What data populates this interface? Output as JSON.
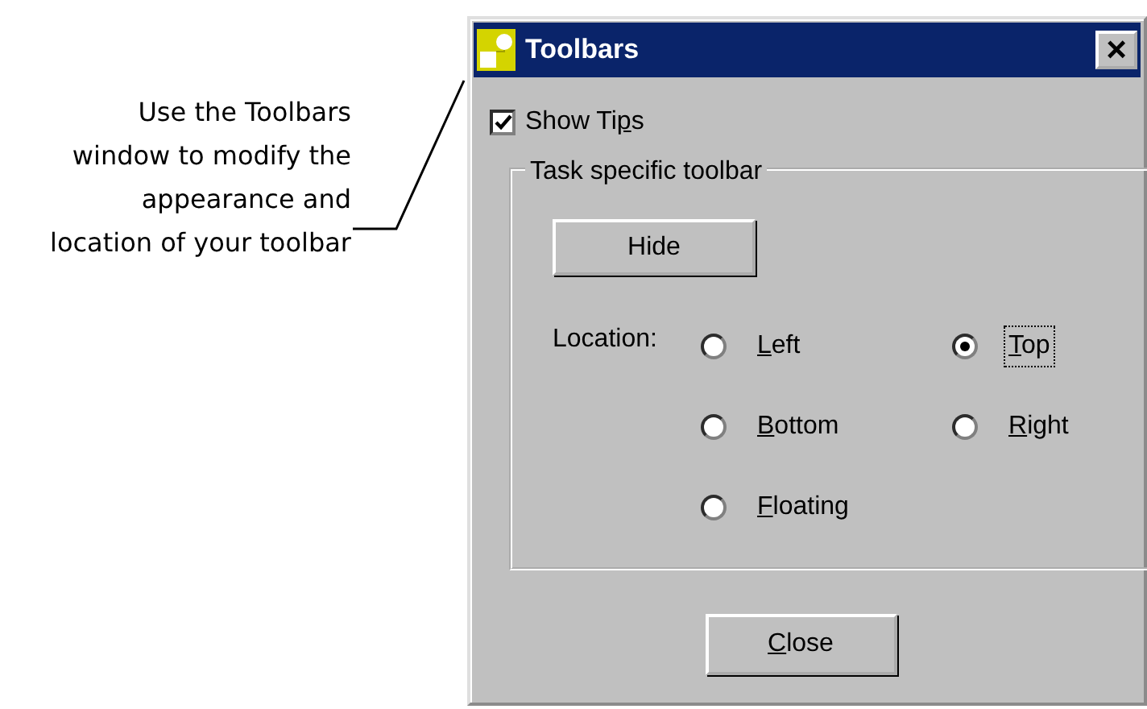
{
  "callout": {
    "text": "Use the Toolbars window to modify the appearance and location of your toolbar"
  },
  "window": {
    "title": "Toolbars",
    "close_glyph": "×"
  },
  "show_tips": {
    "label": [
      {
        "text": "Show Ti",
        "underlined": false
      },
      {
        "text": "p",
        "underlined": true
      },
      {
        "text": "s",
        "underlined": false
      }
    ],
    "checked": true
  },
  "group": {
    "title": "Task specific toolbar",
    "hide_button": "Hide",
    "location_label": "Location:",
    "options": [
      {
        "label": [
          {
            "text": "L",
            "underlined": true
          },
          {
            "text": "eft",
            "underlined": false
          }
        ],
        "selected": false,
        "focused": false
      },
      {
        "label": [
          {
            "text": "T",
            "underlined": true
          },
          {
            "text": "op",
            "underlined": false
          }
        ],
        "selected": true,
        "focused": true
      },
      {
        "label": [
          {
            "text": "B",
            "underlined": true
          },
          {
            "text": "ottom",
            "underlined": false
          }
        ],
        "selected": false,
        "focused": false
      },
      {
        "label": [
          {
            "text": "R",
            "underlined": true
          },
          {
            "text": "ight",
            "underlined": false
          }
        ],
        "selected": false,
        "focused": false
      },
      {
        "label": [
          {
            "text": "F",
            "underlined": true
          },
          {
            "text": "loating",
            "underlined": false
          }
        ],
        "selected": false,
        "focused": false
      }
    ]
  },
  "buttons": [
    {
      "label": [
        {
          "text": "C",
          "underlined": true
        },
        {
          "text": "lose",
          "underlined": false
        }
      ]
    }
  ]
}
